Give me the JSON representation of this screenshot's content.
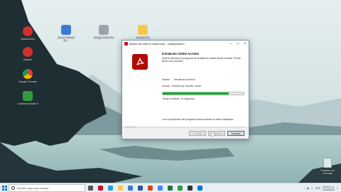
{
  "desktop": {
    "icons": [
      {
        "label": "Optical Boot",
        "icon": "optical-boot-icon",
        "color": "#d0312d"
      },
      {
        "label": "Nuevo Tutorial de...",
        "icon": "tutorial-icon",
        "color": "#3a7bd5"
      },
      {
        "label": "Google Earth Pro",
        "icon": "google-earth-icon",
        "color": "#9aa4ad"
      },
      {
        "label": "Acrobat.Pro",
        "icon": "folder-icon",
        "color": "#f2c94c"
      },
      {
        "label": "Ryzlaer",
        "icon": "ryzlaer-icon",
        "color": "#d0312d"
      },
      {
        "label": "Google Chrome",
        "icon": "chrome-icon",
        "color": "#4285f4"
      },
      {
        "label": "Camtasia Studio 9",
        "icon": "camtasia-icon",
        "color": "#2e9b3c"
      }
    ],
    "recycle_bin": {
      "label": "Papelera de reciclaje",
      "icon": "recycle-bin-icon"
    }
  },
  "installer": {
    "title": "Adobe Acrobat (Continuous) - configuración",
    "heading": "Instalando Adobe Acrobat",
    "description": "Espere mientras el programa de instalación instala Adobe Acrobat. Puede llevar unos minutos.",
    "status_label": "Estado:",
    "status_value": "Revisando archivos",
    "file_text": "Archivo: Touch2p.api   Tamaño: 3orbe",
    "progress_percent": 82,
    "time_remaining": "Tiempo restante: 13 segundos",
    "bottom_note": "Los componentes del programa seleccionados se están instalando.",
    "installshield": "InstallShield",
    "buttons": {
      "back": "< Atrás",
      "next": "Siguiente >",
      "cancel": "Cancelar"
    },
    "brand_color": "#b30b00",
    "progress_color": "#06b025"
  },
  "taskbar": {
    "search_placeholder": "Escribe aquí para buscar.",
    "apps": [
      {
        "name": "task-view-icon",
        "color": "#555555"
      },
      {
        "name": "acrobat-taskbar-icon",
        "color": "#c8102e",
        "active": true
      },
      {
        "name": "edge-icon",
        "color": "#1fa0e0"
      },
      {
        "name": "file-explorer-icon",
        "color": "#f2c94c"
      },
      {
        "name": "store-icon",
        "color": "#3a7bd5"
      },
      {
        "name": "word-icon",
        "color": "#2b579a"
      },
      {
        "name": "powerpoint-icon",
        "color": "#d24726"
      },
      {
        "name": "chrome-taskbar-icon",
        "color": "#4285f4"
      },
      {
        "name": "excel-icon",
        "color": "#217346"
      },
      {
        "name": "camtasia-taskbar-icon",
        "color": "#2e9b3c"
      },
      {
        "name": "terminal-icon",
        "color": "#333333"
      },
      {
        "name": "calendar-icon",
        "color": "#0078d7"
      }
    ],
    "tray_lang": "ESP",
    "clock_time": "01:40 p. m.",
    "clock_date": "11/04/2023"
  }
}
